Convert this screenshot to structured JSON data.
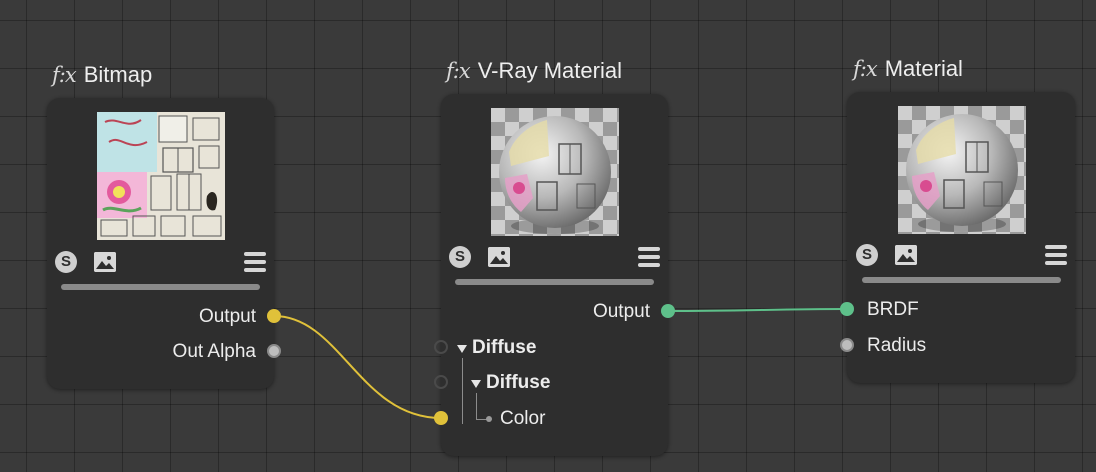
{
  "colors": {
    "canvas": "#3a3a3a",
    "node_background": "#2e2e2e",
    "wire_bitmap_to_vray": "#e0c13a",
    "wire_vray_to_material": "#5ec08a",
    "port_inactive": "#bdbdbd"
  },
  "icons": {
    "function": "fx-icon",
    "shader_toggle": "s-icon",
    "preview_image": "image-icon",
    "menu": "hamburger-menu-icon"
  },
  "nodes": {
    "bitmap": {
      "fx": "f:x",
      "title": "Bitmap",
      "s_label": "S",
      "outputs": [
        "Output",
        "Out Alpha"
      ]
    },
    "vray_material": {
      "fx": "f:x",
      "title": "V-Ray Material",
      "s_label": "S",
      "output": "Output",
      "inputs": {
        "group": "Diffuse",
        "subgroup": "Diffuse",
        "param": "Color"
      }
    },
    "material": {
      "fx": "f:x",
      "title": "Material",
      "s_label": "S",
      "inputs": [
        "BRDF",
        "Radius"
      ]
    }
  },
  "connections": [
    {
      "from": "Bitmap.Output",
      "to": "V-Ray Material.Diffuse.Diffuse.Color"
    },
    {
      "from": "V-Ray Material.Output",
      "to": "Material.BRDF"
    }
  ]
}
